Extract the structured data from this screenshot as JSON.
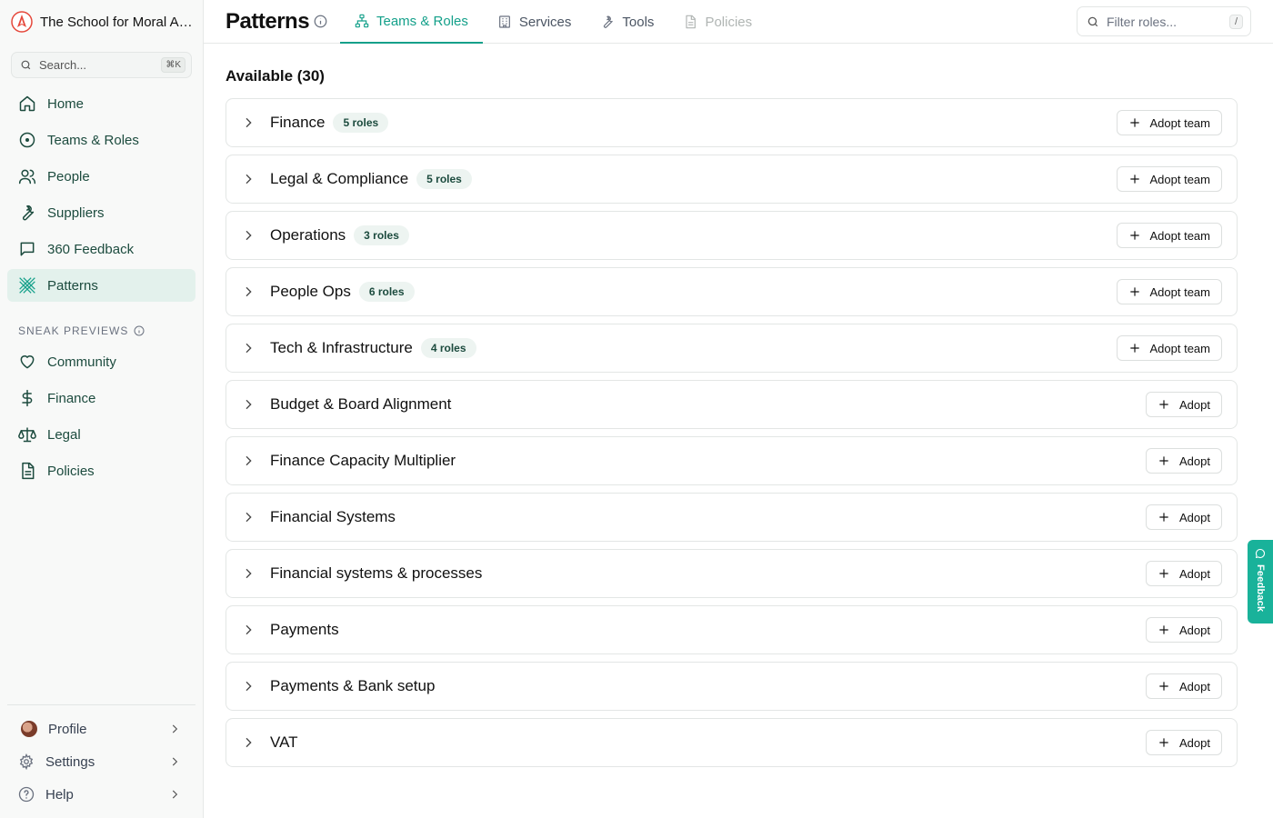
{
  "org": {
    "name": "The School for Moral Ambition"
  },
  "search": {
    "placeholder": "Search...",
    "shortcut": "⌘K"
  },
  "sidebar": {
    "items": [
      {
        "label": "Home",
        "icon": "home-icon"
      },
      {
        "label": "Teams & Roles",
        "icon": "target-icon"
      },
      {
        "label": "People",
        "icon": "users-icon"
      },
      {
        "label": "Suppliers",
        "icon": "wrench-icon"
      },
      {
        "label": "360 Feedback",
        "icon": "message-icon"
      },
      {
        "label": "Patterns",
        "icon": "patterns-icon",
        "active": true
      }
    ],
    "section_label": "SNEAK PREVIEWS",
    "preview_items": [
      {
        "label": "Community",
        "icon": "heart-icon"
      },
      {
        "label": "Finance",
        "icon": "dollar-icon"
      },
      {
        "label": "Legal",
        "icon": "scale-icon"
      },
      {
        "label": "Policies",
        "icon": "document-icon"
      }
    ],
    "bottom": [
      {
        "label": "Profile",
        "icon": "avatar"
      },
      {
        "label": "Settings",
        "icon": "gear-icon"
      },
      {
        "label": "Help",
        "icon": "help-icon"
      }
    ]
  },
  "header": {
    "title": "Patterns",
    "tabs": [
      {
        "label": "Teams & Roles",
        "icon": "org-chart-icon",
        "active": true
      },
      {
        "label": "Services",
        "icon": "building-icon"
      },
      {
        "label": "Tools",
        "icon": "wrench-icon"
      },
      {
        "label": "Policies",
        "icon": "document-icon",
        "disabled": true
      }
    ],
    "filter": {
      "placeholder": "Filter roles...",
      "shortcut": "/"
    }
  },
  "main": {
    "available_label": "Available (30)",
    "teams": [
      {
        "name": "Finance",
        "badge": "5 roles",
        "action": "Adopt team"
      },
      {
        "name": "Legal & Compliance",
        "badge": "5 roles",
        "action": "Adopt team"
      },
      {
        "name": "Operations",
        "badge": "3 roles",
        "action": "Adopt team"
      },
      {
        "name": "People Ops",
        "badge": "6 roles",
        "action": "Adopt team"
      },
      {
        "name": "Tech & Infrastructure",
        "badge": "4 roles",
        "action": "Adopt team"
      }
    ],
    "roles": [
      {
        "name": "Budget & Board Alignment",
        "action": "Adopt"
      },
      {
        "name": "Finance Capacity Multiplier",
        "action": "Adopt"
      },
      {
        "name": "Financial Systems",
        "action": "Adopt"
      },
      {
        "name": "Financial systems & processes",
        "action": "Adopt"
      },
      {
        "name": "Payments",
        "action": "Adopt"
      },
      {
        "name": "Payments & Bank setup",
        "action": "Adopt"
      },
      {
        "name": "VAT",
        "action": "Adopt"
      }
    ]
  },
  "feedback": {
    "label": "Feedback"
  },
  "colors": {
    "accent": "#14a08a",
    "nav_text": "#1c4b3e",
    "active_bg": "#e3f1ec",
    "feedback_bg": "#19b29a"
  }
}
